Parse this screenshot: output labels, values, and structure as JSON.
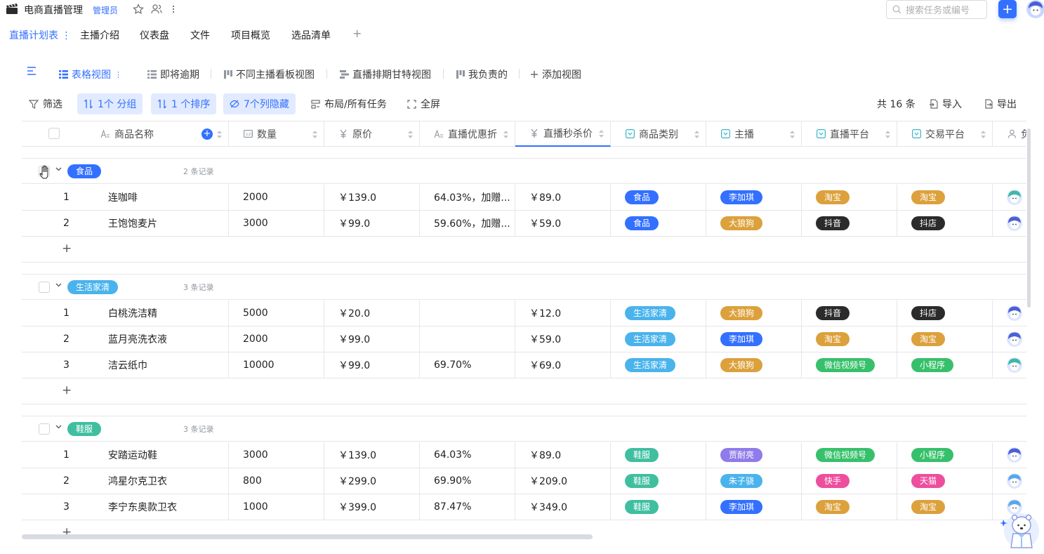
{
  "app": {
    "title": "电商直播管理",
    "role": "管理员",
    "search_placeholder": "搜索任务或编号",
    "add_label": "+"
  },
  "tabs": [
    {
      "label": "直播计划表 ⋮",
      "active": true
    },
    {
      "label": "主播介绍"
    },
    {
      "label": "仪表盘"
    },
    {
      "label": "文件"
    },
    {
      "label": "项目概览"
    },
    {
      "label": "选品清单"
    },
    {
      "label": "+"
    }
  ],
  "views": [
    {
      "label": "表格视图",
      "active": true,
      "icon": "table-icon"
    },
    {
      "label": "即将逾期",
      "icon": "list-icon"
    },
    {
      "label": "不同主播看板视图",
      "icon": "kanban-icon"
    },
    {
      "label": "直播排期甘特视图",
      "icon": "gantt-icon"
    },
    {
      "label": "我负责的",
      "icon": "kanban-icon"
    },
    {
      "label": "添加视图",
      "icon": "plus-icon"
    }
  ],
  "toolbar": {
    "filter": "筛选",
    "group": "1个 分组",
    "sort": "1 个排序",
    "hidden": "7个列隐藏",
    "layout": "布局/所有任务",
    "fullscreen": "全屏",
    "total": "共 16 条",
    "import": "导入",
    "export": "导出"
  },
  "columns": [
    {
      "label": "商品名称",
      "icon": "text-type-icon"
    },
    {
      "label": "数量",
      "icon": "number-type-icon"
    },
    {
      "label": "原价",
      "icon": "currency-type-icon"
    },
    {
      "label": "直播优惠折",
      "icon": "text-type-icon"
    },
    {
      "label": "直播秒杀价",
      "icon": "currency-type-icon"
    },
    {
      "label": "商品类别",
      "icon": "select-type-icon"
    },
    {
      "label": "主播",
      "icon": "select-type-icon"
    },
    {
      "label": "直播平台",
      "icon": "select-type-icon"
    },
    {
      "label": "交易平台",
      "icon": "select-type-icon"
    },
    {
      "label": "负",
      "icon": "person-type-icon"
    }
  ],
  "colors": {
    "blue": "#3370ff",
    "food": "#3370ff",
    "home": "#4ab3ec",
    "shoes": "#3fbfa0",
    "lijiaqi": "#3370ff",
    "dalanggou": "#dca13c",
    "jianaliang": "#8f7bea",
    "zhuzixiao": "#4ab3ec",
    "taobao": "#dca13c",
    "douyin": "#2b2b2b",
    "weixin": "#37c06b",
    "kuaishou": "#ee4e9e",
    "tianmao": "#ee4e9e"
  },
  "groups": [
    {
      "tag": "食品",
      "color": "#3370ff",
      "count": "2 条记录",
      "rows": [
        {
          "idx": "1",
          "name": "连咖啡",
          "qty": "2000",
          "price": "￥139.0",
          "discount": "64.03%，加赠...",
          "flash": "￥89.0",
          "cat": "食品",
          "host": "李加琪",
          "live": "淘宝",
          "trade": "淘宝",
          "cat_c": "#3370ff",
          "host_c": "#3370ff",
          "live_c": "#dca13c",
          "trade_c": "#dca13c",
          "av": "teal"
        },
        {
          "idx": "2",
          "name": "王饱饱麦片",
          "qty": "3000",
          "price": "￥99.0",
          "discount": "59.60%，加赠...",
          "flash": "￥59.0",
          "cat": "食品",
          "host": "大狼狗",
          "live": "抖音",
          "trade": "抖店",
          "cat_c": "#3370ff",
          "host_c": "#dca13c",
          "live_c": "#2b2b2b",
          "trade_c": "#2b2b2b",
          "av": "blue"
        }
      ]
    },
    {
      "tag": "生活家清",
      "color": "#4ab3ec",
      "count": "3 条记录",
      "rows": [
        {
          "idx": "1",
          "name": "白桃洗洁精",
          "qty": "5000",
          "price": "￥20.0",
          "discount": "",
          "flash": "￥12.0",
          "cat": "生活家清",
          "host": "大狼狗",
          "live": "抖音",
          "trade": "抖店",
          "cat_c": "#4ab3ec",
          "host_c": "#dca13c",
          "live_c": "#2b2b2b",
          "trade_c": "#2b2b2b",
          "av": "blue"
        },
        {
          "idx": "2",
          "name": "蓝月亮洗衣液",
          "qty": "2000",
          "price": "￥99.0",
          "discount": "",
          "flash": "￥59.0",
          "cat": "生活家清",
          "host": "李加琪",
          "live": "淘宝",
          "trade": "淘宝",
          "cat_c": "#4ab3ec",
          "host_c": "#3370ff",
          "live_c": "#dca13c",
          "trade_c": "#dca13c",
          "av": "blue"
        },
        {
          "idx": "3",
          "name": "洁云纸巾",
          "qty": "10000",
          "price": "￥99.0",
          "discount": "69.70%",
          "flash": "￥69.0",
          "cat": "生活家清",
          "host": "大狼狗",
          "live": "微信视频号",
          "trade": "小程序",
          "cat_c": "#4ab3ec",
          "host_c": "#dca13c",
          "live_c": "#37c06b",
          "trade_c": "#37c06b",
          "av": "teal"
        }
      ]
    },
    {
      "tag": "鞋服",
      "color": "#3fbfa0",
      "count": "3 条记录",
      "rows": [
        {
          "idx": "1",
          "name": "安踏运动鞋",
          "qty": "3000",
          "price": "￥139.0",
          "discount": "64.03%",
          "flash": "￥89.0",
          "cat": "鞋服",
          "host": "贾耐亮",
          "live": "微信视频号",
          "trade": "小程序",
          "cat_c": "#3fbfa0",
          "host_c": "#8f7bea",
          "live_c": "#37c06b",
          "trade_c": "#37c06b",
          "av": "blue"
        },
        {
          "idx": "2",
          "name": "鸿星尔克卫衣",
          "qty": "800",
          "price": "￥299.0",
          "discount": "69.90%",
          "flash": "￥209.0",
          "cat": "鞋服",
          "host": "朱子骁",
          "live": "快手",
          "trade": "天猫",
          "cat_c": "#3fbfa0",
          "host_c": "#4ab3ec",
          "live_c": "#ee4e9e",
          "trade_c": "#ee4e9e",
          "av": "sky"
        },
        {
          "idx": "3",
          "name": "李宁东奥款卫衣",
          "qty": "1000",
          "price": "￥399.0",
          "discount": "87.47%",
          "flash": "￥349.0",
          "cat": "鞋服",
          "host": "李加琪",
          "live": "淘宝",
          "trade": "淘宝",
          "cat_c": "#3fbfa0",
          "host_c": "#3370ff",
          "live_c": "#dca13c",
          "trade_c": "#dca13c",
          "av": "sky"
        }
      ]
    }
  ]
}
